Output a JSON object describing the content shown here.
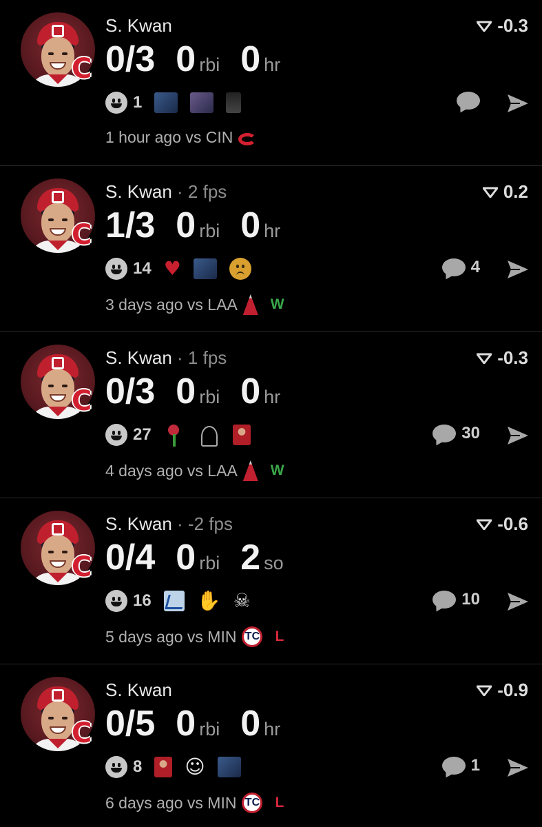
{
  "colors": {
    "background": "#000000",
    "win": "#3aa84a",
    "loss": "#d8283a",
    "guardians_red": "#d21f2f"
  },
  "posts": [
    {
      "player": "S. Kwan",
      "fps": "",
      "score": "-0.3",
      "ab": "0/3",
      "rbi": "0",
      "third_value": "0",
      "third_unit": "hr",
      "reaction_count": "1",
      "reactions": [
        "thumb-blue",
        "thumb-purple",
        "thumb-dark"
      ],
      "comment_count": "",
      "time": "1 hour ago vs CIN",
      "opp_logo": "reds-logo",
      "result": ""
    },
    {
      "player": "S. Kwan",
      "fps": " · 2 fps",
      "score": "0.2",
      "ab": "1/3",
      "rbi": "0",
      "third_value": "0",
      "third_unit": "hr",
      "reaction_count": "14",
      "reactions": [
        "broken-heart-icon",
        "thumb-blue-player",
        "sad-face-icon"
      ],
      "comment_count": "4",
      "time": "3 days ago vs LAA",
      "opp_logo": "angels-logo",
      "result": "W"
    },
    {
      "player": "S. Kwan",
      "fps": " · 1 fps",
      "score": "-0.3",
      "ab": "0/3",
      "rbi": "0",
      "third_value": "0",
      "third_unit": "hr",
      "reaction_count": "27",
      "reactions": [
        "rose-icon",
        "kick-icon",
        "thumb-red"
      ],
      "comment_count": "30",
      "time": "4 days ago vs LAA",
      "opp_logo": "angels-logo",
      "result": "W"
    },
    {
      "player": "S. Kwan",
      "fps": " · -2 fps",
      "score": "-0.6",
      "ab": "0/4",
      "rbi": "0",
      "third_value": "2",
      "third_unit": "so",
      "reaction_count": "16",
      "reactions": [
        "chart-down-icon",
        "middle-finger-icon",
        "skull-icon"
      ],
      "comment_count": "10",
      "time": "5 days ago vs MIN",
      "opp_logo": "twins-logo",
      "result": "L"
    },
    {
      "player": "S. Kwan",
      "fps": "",
      "score": "-0.9",
      "ab": "0/5",
      "rbi": "0",
      "third_value": "0",
      "third_unit": "hr",
      "reaction_count": "8",
      "reactions": [
        "thumb-red",
        "ghost-icon",
        "thumb-blue"
      ],
      "comment_count": "1",
      "time": "6 days ago vs MIN",
      "opp_logo": "twins-logo",
      "result": "L"
    }
  ],
  "labels": {
    "rbi_unit": "rbi",
    "twins_mark": "TC"
  }
}
